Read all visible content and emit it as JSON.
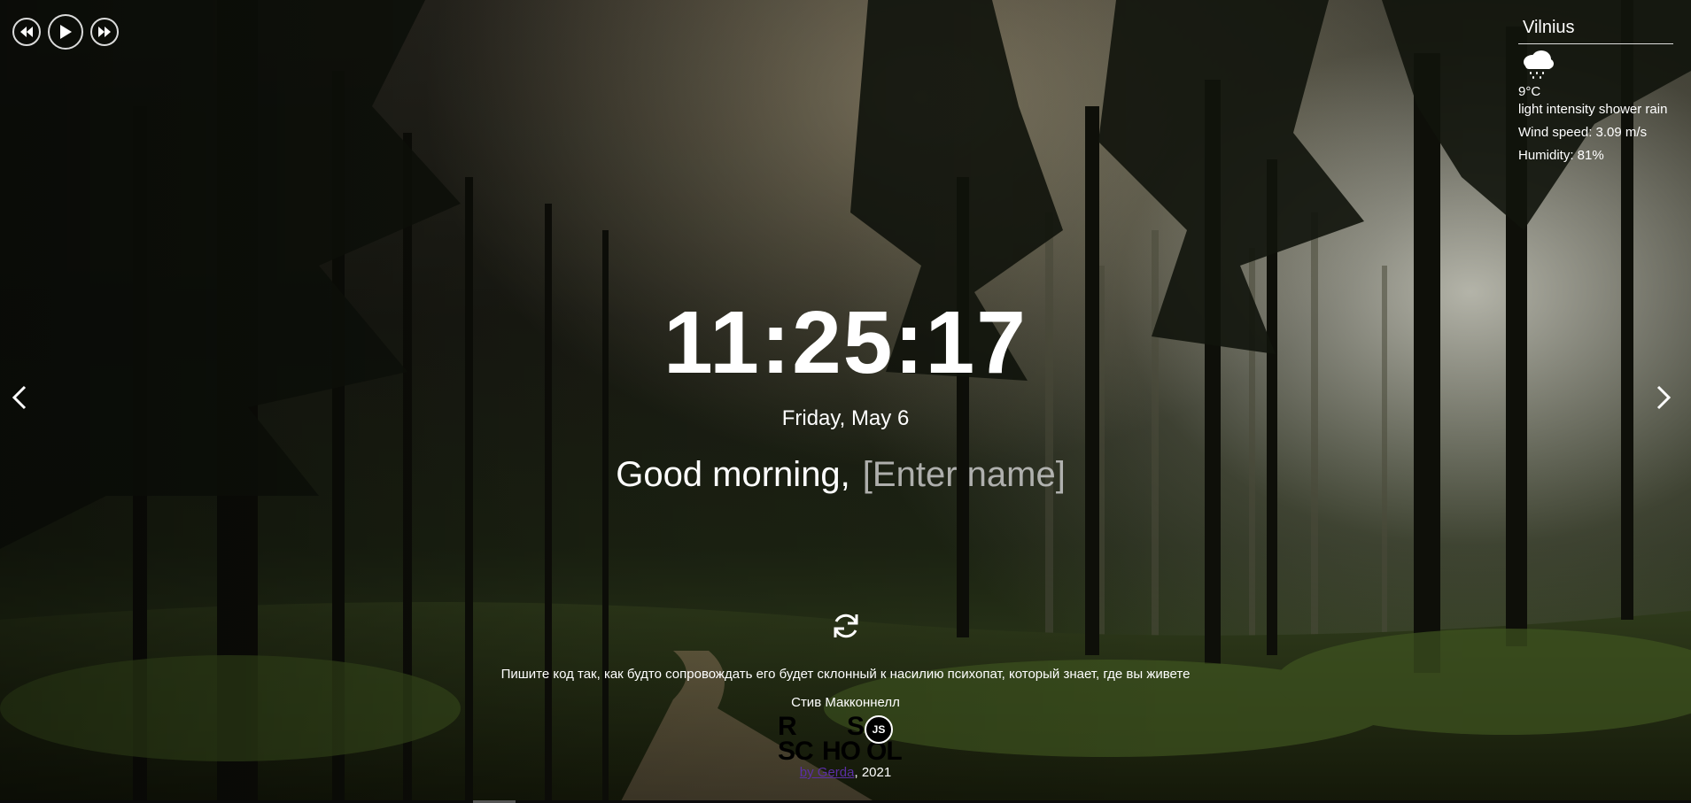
{
  "player": {
    "icons": [
      "rewind-icon",
      "play-icon",
      "fast-forward-icon"
    ]
  },
  "weather": {
    "city": "Vilnius",
    "icon": "rain-cloud-icon",
    "temperature": "9°C",
    "description": "light intensity shower rain",
    "wind": "Wind speed: 3.09 m/s",
    "humidity": "Humidity: 81%"
  },
  "slider": {
    "prev_icon": "chevron-left-icon",
    "next_icon": "chevron-right-icon"
  },
  "clock": {
    "time": "11:25:17",
    "date": "Friday, May 6"
  },
  "greeting": {
    "text": "Good morning,",
    "name_placeholder": "[Enter name]"
  },
  "quote": {
    "change_icon": "refresh-icon",
    "text": "Пишите код так, как будто сопровождать его будет склонный к насилию психопат, который знает, где вы живете",
    "author": "Стив Макконнелл"
  },
  "footer": {
    "logo_letters": [
      "R",
      "S",
      "SC",
      "HO",
      "OL"
    ],
    "logo_badge": "JS",
    "github_link": "by Gerda",
    "year": ", 2021"
  },
  "colors": {
    "text": "#ffffff",
    "link": "#5b2fa5",
    "overlay": "#000000"
  }
}
